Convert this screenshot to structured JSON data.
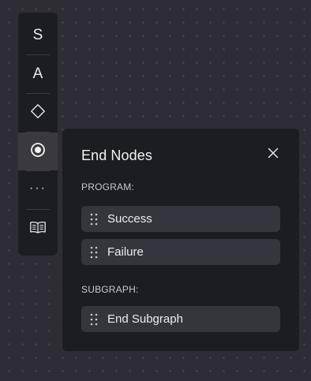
{
  "toolbar": {
    "items": [
      {
        "id": "start",
        "label": "S"
      },
      {
        "id": "action",
        "label": "A"
      },
      {
        "id": "decision",
        "icon": "diamond-icon"
      },
      {
        "id": "end",
        "icon": "radio-target-icon",
        "active": true
      },
      {
        "id": "more",
        "label": "···"
      },
      {
        "id": "library",
        "icon": "open-book-icon"
      }
    ]
  },
  "panel": {
    "title": "End Nodes",
    "close_icon": "close-icon",
    "sections": [
      {
        "label": "PROGRAM:",
        "items": [
          {
            "label": "Success"
          },
          {
            "label": "Failure"
          }
        ]
      },
      {
        "label": "SUBGRAPH:",
        "items": [
          {
            "label": "End Subgraph"
          }
        ]
      }
    ]
  },
  "colors": {
    "canvas": "#2e2d35",
    "panel": "#1c1d23",
    "item": "#34353d",
    "active_tool": "#3a3940",
    "text": "#ececf0"
  }
}
